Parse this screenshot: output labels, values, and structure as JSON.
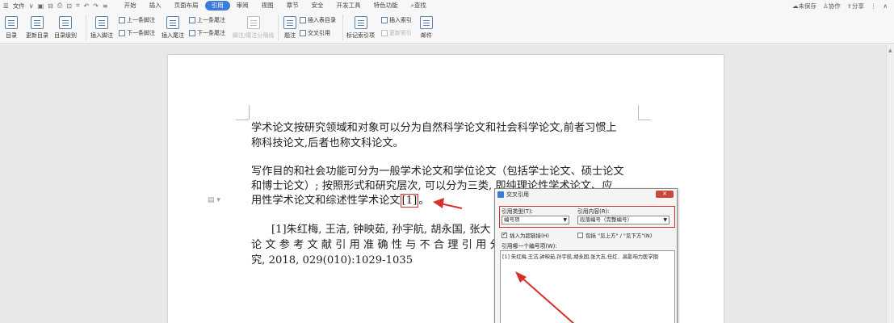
{
  "menubar": {
    "file_label": "文件",
    "tabs": [
      {
        "label": "开始",
        "active": false
      },
      {
        "label": "插入",
        "active": false
      },
      {
        "label": "页面布局",
        "active": false
      },
      {
        "label": "引用",
        "active": true
      },
      {
        "label": "审阅",
        "active": false
      },
      {
        "label": "视图",
        "active": false
      },
      {
        "label": "章节",
        "active": false
      },
      {
        "label": "安全",
        "active": false
      },
      {
        "label": "开发工具",
        "active": false
      },
      {
        "label": "特色功能",
        "active": false
      }
    ],
    "search_label": "查找",
    "unsaved_label": "未保存",
    "collab_label": "协作",
    "share_label": "分享"
  },
  "ribbon": {
    "toc": "目录",
    "update_toc": "更新目录",
    "toc_level": "目录级别",
    "insert_footnote": "插入脚注",
    "prev_footnote": "上一条脚注",
    "next_footnote": "下一条脚注",
    "insert_endnote": "插入尾注",
    "prev_endnote": "上一条尾注",
    "next_endnote": "下一条尾注",
    "separator": "脚注/尾注分隔线",
    "caption": "题注",
    "insert_table_toc": "插入表目录",
    "cross_ref": "交叉引用",
    "mark_index": "标记索引项",
    "insert_index": "插入索引",
    "update_index": "更新索引",
    "mail": "邮件"
  },
  "document": {
    "p1_line1": "学术论文按研究领域和对象可以分为自然科学论文和社会科学论文,前者习惯上",
    "p1_line2": "称科技论文,后者也称文科论文。",
    "p2_line1": "写作目的和社会功能可分为一般学术论文和学位论文（包括学士论文、硕士论文",
    "p2_line2": "和博士论文）; 按照形式和研究层次, 可以分为三类, 即纯理论性学术论文、应",
    "p2_line3_pre": "用性学术论文和综述性学术论文",
    "citation": "[1]",
    "p2_line3_post": "。",
    "ref_line1": "[1]朱红梅, 王洁, 钟映茹, 孙宇航, 胡永国, 张大",
    "ref_line2": "论 文 参 考 文 献 引 用 准 确 性 与 不 合 理 引 用 分",
    "ref_line3": "究, 2018, 029(010):1029-1035"
  },
  "dialog": {
    "title": "交叉引用",
    "close_label": "✕",
    "ref_type_label": "引用类型(T):",
    "ref_type_value": "编号项",
    "ref_content_label": "引用内容(R):",
    "ref_content_value": "段落编号（完整编号）",
    "insert_hyperlink_label": "插入为超链接(H)",
    "insert_hyperlink_checked": true,
    "include_above_below_label": "包括 \"见上方\" / \"见下方\"(N)",
    "include_above_below_checked": false,
    "which_item_label": "引用哪一个编号项(W):",
    "items": [
      "[1] 朱红梅,王洁,钟映茹,孙宇航,胡永国,张大志,任红．高影响力医学期"
    ]
  },
  "colors": {
    "accent": "#3b7bd9",
    "annotation_red": "#d3312a"
  }
}
